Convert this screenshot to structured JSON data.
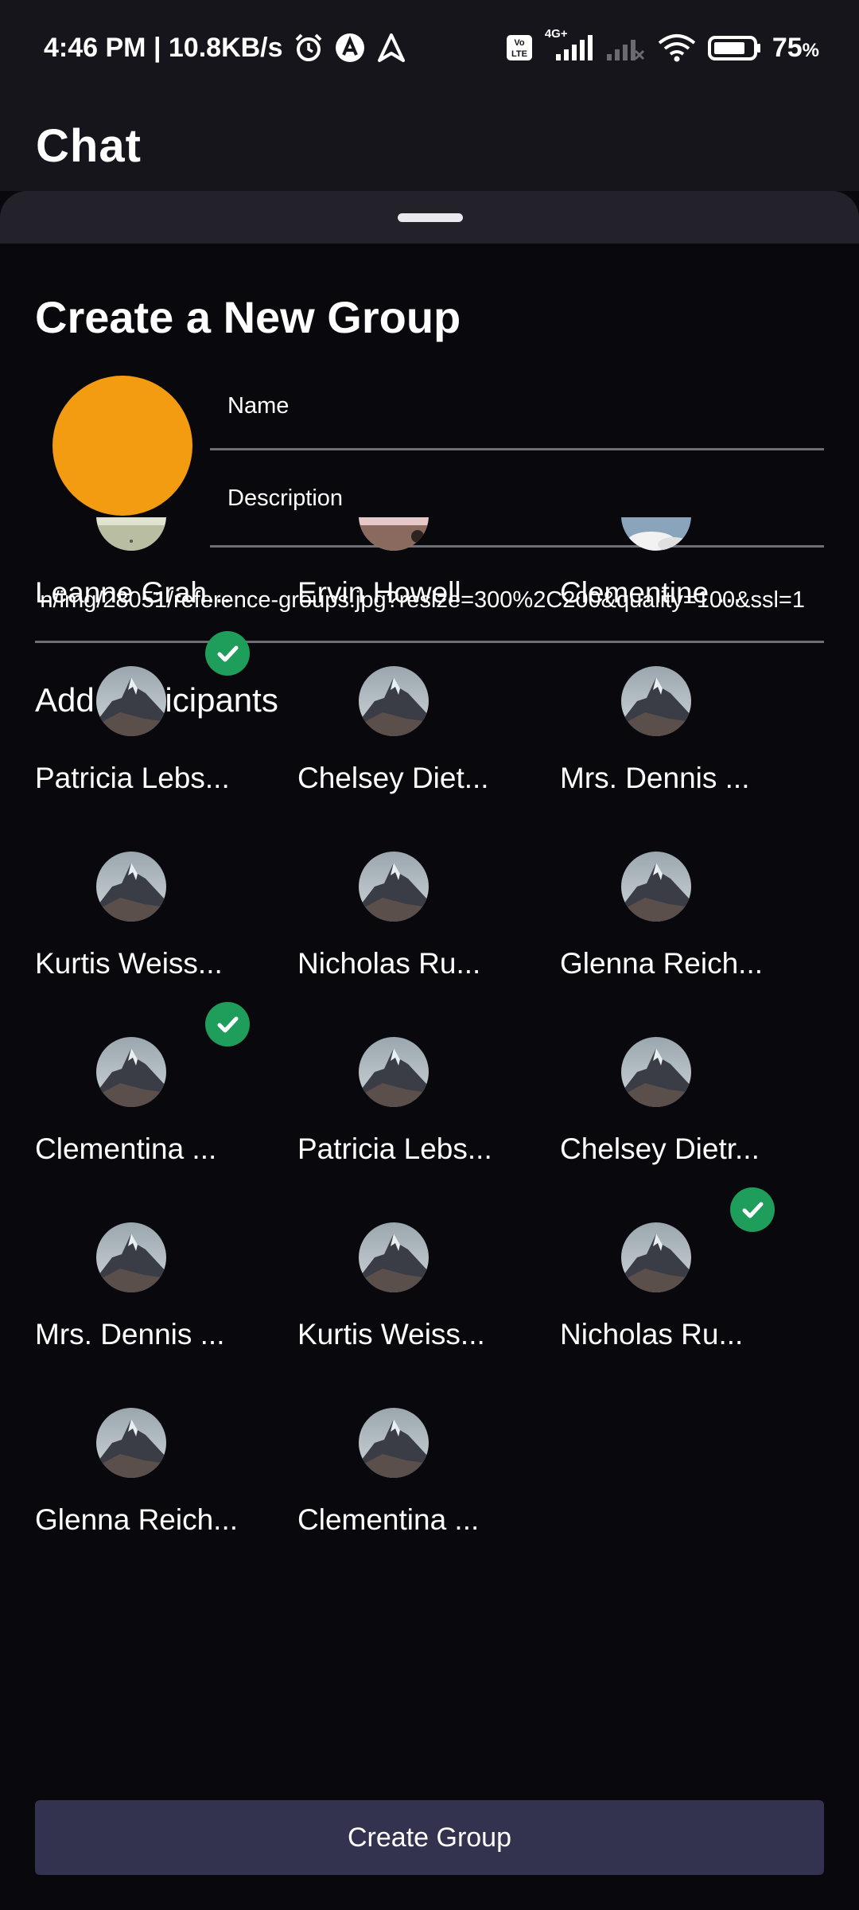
{
  "status_bar": {
    "time_speed": "4:46 PM | 10.8KB/s",
    "network": "4G+",
    "battery": "75",
    "battery_unit": "%",
    "icons": [
      "alarm-icon",
      "app-a-icon",
      "navigation-icon",
      "volte-icon",
      "signal-icon",
      "signal-off-icon",
      "wifi-icon",
      "battery-icon"
    ]
  },
  "header": {
    "title": "Chat"
  },
  "sheet": {
    "title": "Create a New Group",
    "name_label": "Name",
    "description_label": "Description",
    "image_url": "n/img/28051/reference-groups.jpg?resize=300%2C200&quality=100&ssl=1",
    "avatar_color": "#f39c12",
    "participants_title": "Add Participants",
    "create_button": "Create Group"
  },
  "participants": [
    {
      "name": "Leanne Grah...",
      "selected": false,
      "photo": "landscape-1"
    },
    {
      "name": "Ervin Howell",
      "selected": false,
      "photo": "landscape-2"
    },
    {
      "name": "Clementine ...",
      "selected": false,
      "photo": "landscape-3"
    },
    {
      "name": "Patricia Lebs...",
      "selected": true,
      "photo": "mountain"
    },
    {
      "name": "Chelsey Diet...",
      "selected": false,
      "photo": "mountain"
    },
    {
      "name": "Mrs. Dennis ...",
      "selected": false,
      "photo": "mountain"
    },
    {
      "name": "Kurtis Weiss...",
      "selected": false,
      "photo": "mountain"
    },
    {
      "name": "Nicholas Ru...",
      "selected": false,
      "photo": "mountain"
    },
    {
      "name": "Glenna Reich...",
      "selected": false,
      "photo": "mountain"
    },
    {
      "name": "Clementina ...",
      "selected": true,
      "photo": "mountain"
    },
    {
      "name": "Patricia Lebs...",
      "selected": false,
      "photo": "mountain"
    },
    {
      "name": "Chelsey Dietr...",
      "selected": false,
      "photo": "mountain"
    },
    {
      "name": "Mrs. Dennis ...",
      "selected": false,
      "photo": "mountain"
    },
    {
      "name": "Kurtis Weiss...",
      "selected": false,
      "photo": "mountain"
    },
    {
      "name": "Nicholas Ru...",
      "selected": true,
      "photo": "mountain"
    },
    {
      "name": "Glenna Reich...",
      "selected": false,
      "photo": "mountain"
    },
    {
      "name": "Clementina ...",
      "selected": false,
      "photo": "mountain"
    }
  ],
  "colors": {
    "background": "#09080d",
    "header": "#16151b",
    "check": "#1f9d5a",
    "button": "#33334f"
  }
}
